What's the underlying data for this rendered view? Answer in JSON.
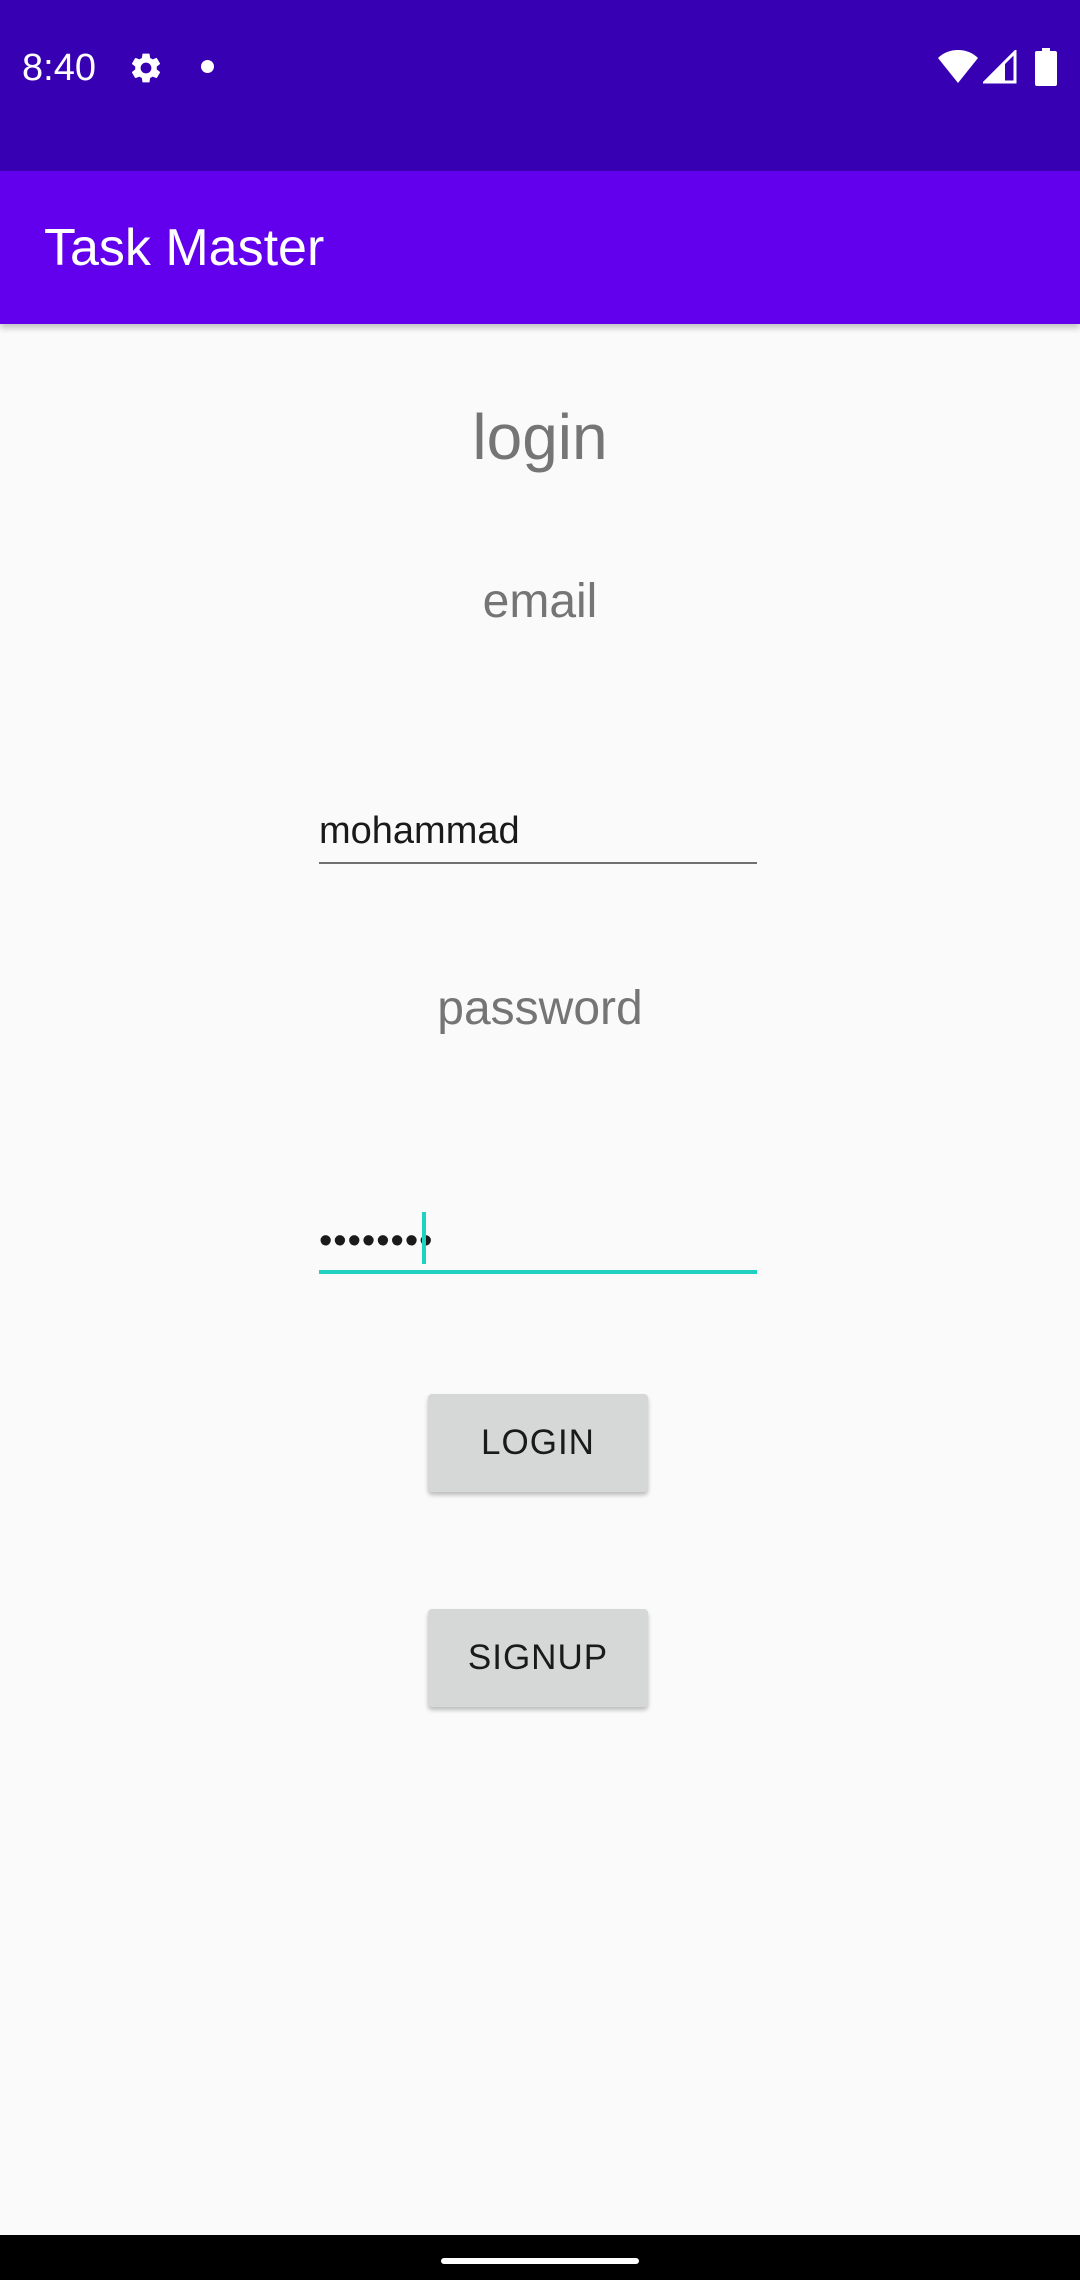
{
  "status_bar": {
    "time": "8:40",
    "background_color": "#3700B3",
    "icons": [
      "gear-icon",
      "notification-dot-icon",
      "wifi-icon",
      "signal-icon",
      "battery-icon"
    ]
  },
  "app_bar": {
    "title": "Task Master",
    "background_color": "#6200EE"
  },
  "login_form": {
    "heading": "login",
    "email_label": "email",
    "email_value": "mohammad",
    "password_label": "password",
    "password_value": "••••••••",
    "accent_color": "#1FD1BF",
    "login_button": "LOGIN",
    "signup_button": "SIGNUP"
  }
}
